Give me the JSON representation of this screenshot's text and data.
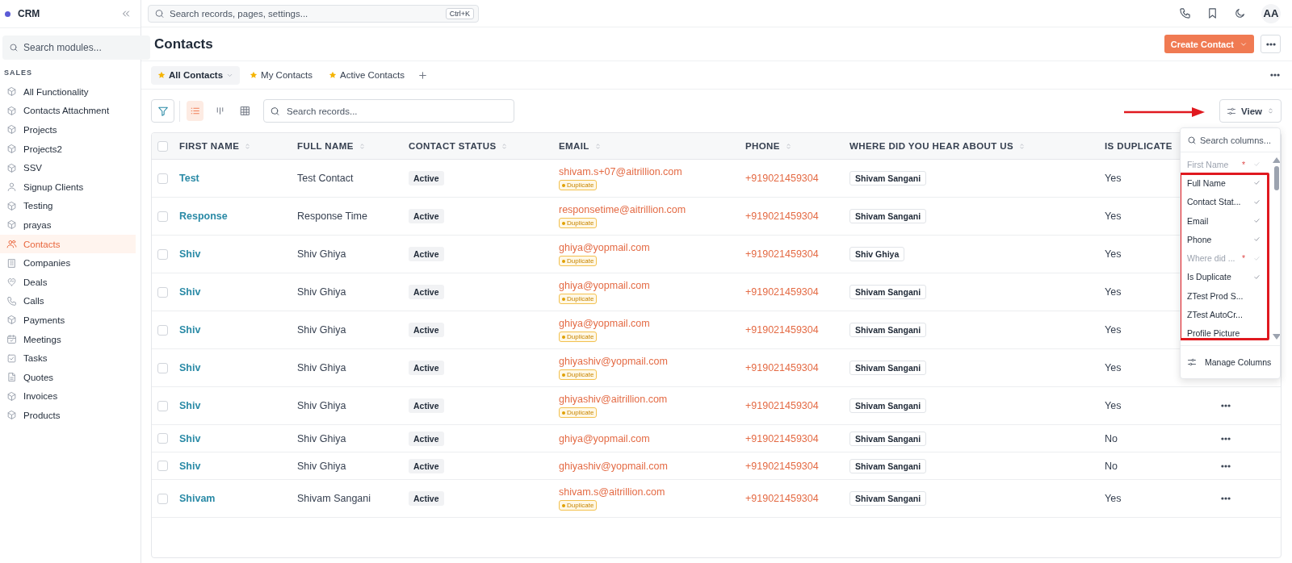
{
  "sidebar": {
    "brand": "CRM",
    "search_placeholder": "Search modules...",
    "section": "SALES",
    "items": [
      {
        "label": "All Functionality",
        "kind": "module",
        "selected": false
      },
      {
        "label": "Contacts Attachment",
        "kind": "module",
        "selected": false
      },
      {
        "label": "Projects",
        "kind": "module",
        "selected": false
      },
      {
        "label": "Projects2",
        "kind": "module",
        "selected": false
      },
      {
        "label": "SSV",
        "kind": "module",
        "selected": false
      },
      {
        "label": "Signup Clients",
        "kind": "user",
        "selected": false
      },
      {
        "label": "Testing",
        "kind": "module",
        "selected": false
      },
      {
        "label": "prayas",
        "kind": "module",
        "selected": false
      },
      {
        "label": "Contacts",
        "kind": "users",
        "selected": true
      },
      {
        "label": "Companies",
        "kind": "building",
        "selected": false
      },
      {
        "label": "Deals",
        "kind": "heart",
        "selected": false
      },
      {
        "label": "Calls",
        "kind": "phone",
        "selected": false
      },
      {
        "label": "Payments",
        "kind": "module",
        "selected": false
      },
      {
        "label": "Meetings",
        "kind": "calendar",
        "selected": false
      },
      {
        "label": "Tasks",
        "kind": "task",
        "selected": false
      },
      {
        "label": "Quotes",
        "kind": "file",
        "selected": false
      },
      {
        "label": "Invoices",
        "kind": "module",
        "selected": false
      },
      {
        "label": "Products",
        "kind": "module",
        "selected": false
      }
    ]
  },
  "topbar": {
    "search_placeholder": "Search records, pages, settings...",
    "shortcut": "Ctrl+K",
    "avatar": "AA"
  },
  "page": {
    "title": "Contacts",
    "create_button": "Create Contact"
  },
  "tabs": [
    {
      "label": "All Contacts",
      "selected": true,
      "dropdown": true
    },
    {
      "label": "My Contacts",
      "selected": false,
      "dropdown": false
    },
    {
      "label": "Active Contacts",
      "selected": false,
      "dropdown": false
    }
  ],
  "toolbar": {
    "views": [
      {
        "kind": "list",
        "selected": true
      },
      {
        "kind": "kanban",
        "selected": false
      },
      {
        "kind": "grid",
        "selected": false
      }
    ],
    "search_placeholder": "Search records...",
    "view_button": "View"
  },
  "table": {
    "all_checked": false,
    "columns": [
      "FIRST NAME",
      "FULL NAME",
      "CONTACT STATUS",
      "EMAIL",
      "PHONE",
      "WHERE DID YOU HEAR ABOUT US",
      "IS DUPLICATE"
    ],
    "rows": [
      {
        "checked": false,
        "first_name": "Test",
        "full_name": "Test Contact",
        "status": "Active",
        "email": "shivam.s+07@aitrillion.com",
        "badge": "Duplicate",
        "phone": "+919021459304",
        "source": "Shivam Sangani",
        "is_duplicate": "Yes"
      },
      {
        "checked": false,
        "first_name": "Response",
        "full_name": "Response Time",
        "status": "Active",
        "email": "responsetime@aitrillion.com",
        "badge": "Duplicate",
        "phone": "+919021459304",
        "source": "Shivam Sangani",
        "is_duplicate": "Yes"
      },
      {
        "checked": false,
        "first_name": "Shiv",
        "full_name": "Shiv Ghiya",
        "status": "Active",
        "email": "ghiya@yopmail.com",
        "badge": "Duplicate",
        "phone": "+919021459304",
        "source": "Shiv Ghiya",
        "is_duplicate": "Yes"
      },
      {
        "checked": false,
        "first_name": "Shiv",
        "full_name": "Shiv Ghiya",
        "status": "Active",
        "email": "ghiya@yopmail.com",
        "badge": "Duplicate",
        "phone": "+919021459304",
        "source": "Shivam Sangani",
        "is_duplicate": "Yes"
      },
      {
        "checked": false,
        "first_name": "Shiv",
        "full_name": "Shiv Ghiya",
        "status": "Active",
        "email": "ghiya@yopmail.com",
        "badge": "Duplicate",
        "phone": "+919021459304",
        "source": "Shivam Sangani",
        "is_duplicate": "Yes"
      },
      {
        "checked": false,
        "first_name": "Shiv",
        "full_name": "Shiv Ghiya",
        "status": "Active",
        "email": "ghiyashiv@yopmail.com",
        "badge": "Duplicate",
        "phone": "+919021459304",
        "source": "Shivam Sangani",
        "is_duplicate": "Yes"
      },
      {
        "checked": false,
        "first_name": "Shiv",
        "full_name": "Shiv Ghiya",
        "status": "Active",
        "email": "ghiyashiv@aitrillion.com",
        "badge": "Duplicate",
        "phone": "+919021459304",
        "source": "Shivam Sangani",
        "is_duplicate": "Yes",
        "actions": true
      },
      {
        "checked": false,
        "first_name": "Shiv",
        "full_name": "Shiv Ghiya",
        "status": "Active",
        "email": "ghiya@yopmail.com",
        "phone": "+919021459304",
        "source": "Shivam Sangani",
        "is_duplicate": "No",
        "actions": true
      },
      {
        "checked": false,
        "first_name": "Shiv",
        "full_name": "Shiv Ghiya",
        "status": "Active",
        "email": "ghiyashiv@yopmail.com",
        "phone": "+919021459304",
        "source": "Shivam Sangani",
        "is_duplicate": "No",
        "actions": true
      },
      {
        "checked": false,
        "first_name": "Shivam",
        "full_name": "Shivam Sangani",
        "status": "Active",
        "email": "shivam.s@aitrillion.com",
        "badge": "Duplicate",
        "phone": "+919021459304",
        "source": "Shivam Sangani",
        "is_duplicate": "Yes",
        "actions": true
      }
    ]
  },
  "column_menu": {
    "search_placeholder": "Search columns...",
    "items": [
      {
        "label": "First Name",
        "mark": "*",
        "checked": true,
        "disabled": true
      },
      {
        "label": "Full Name",
        "checked": true,
        "disabled": false
      },
      {
        "label": "Contact Stat...",
        "checked": true,
        "disabled": false
      },
      {
        "label": "Email",
        "checked": true,
        "disabled": false
      },
      {
        "label": "Phone",
        "checked": true,
        "disabled": false
      },
      {
        "label": "Where did ...",
        "mark": "*",
        "checked": true,
        "disabled": true
      },
      {
        "label": "Is Duplicate",
        "checked": true,
        "disabled": false
      },
      {
        "label": "ZTest Prod S...",
        "checked": false,
        "disabled": false
      },
      {
        "label": "ZTest AutoCr...",
        "checked": false,
        "disabled": false
      },
      {
        "label": "Profile Picture",
        "checked": false,
        "disabled": false
      }
    ],
    "footer": "Manage Columns"
  }
}
